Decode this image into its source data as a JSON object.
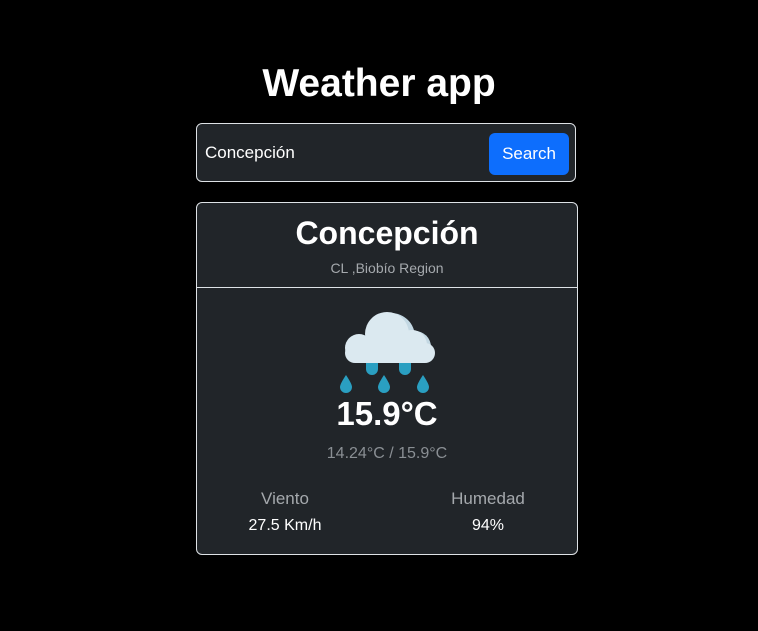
{
  "app": {
    "title": "Weather app"
  },
  "search": {
    "value": "Concepción",
    "button_label": "Search"
  },
  "location": {
    "city": "Concepción",
    "region": "CL ,Biobío Region"
  },
  "weather": {
    "icon": "rain-cloud-icon",
    "temperature": "15.9°C",
    "temp_range": "14.24°C / 15.9°C"
  },
  "stats": {
    "wind_label": "Viento",
    "wind_value": "27.5 Km/h",
    "humidity_label": "Humedad",
    "humidity_value": "94%"
  },
  "colors": {
    "background": "#000000",
    "card": "#212529",
    "accent": "#0d6efd",
    "border": "#dee2e6",
    "cloud": "#dbe9f0",
    "rain": "#2a9fc1"
  }
}
